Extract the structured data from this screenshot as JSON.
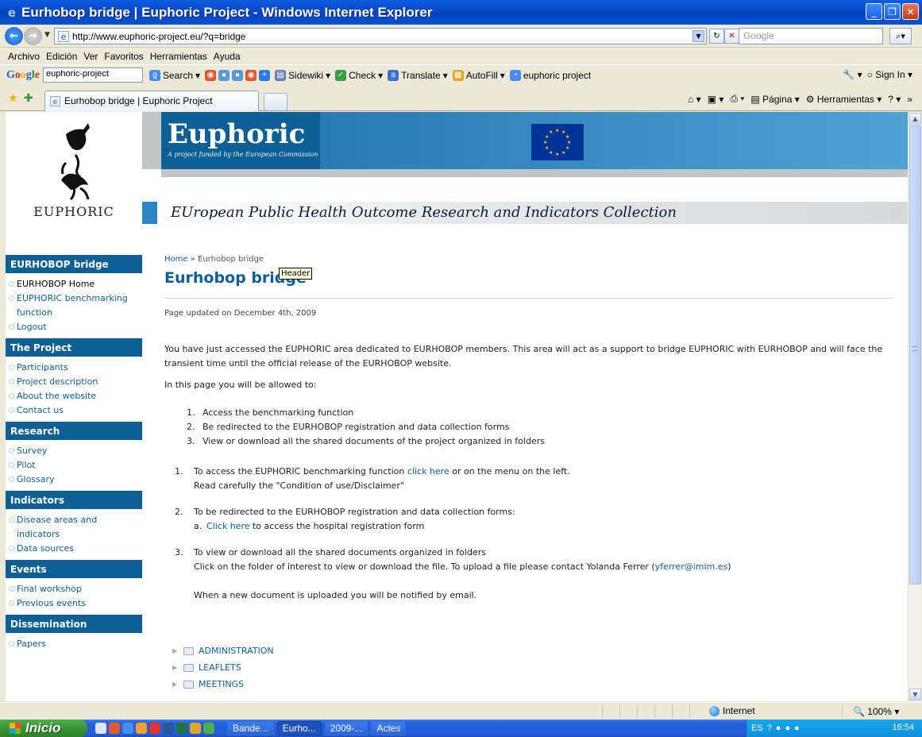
{
  "window": {
    "title": "Eurhobop bridge | Euphoric Project - Windows Internet Explorer"
  },
  "address": {
    "url": "http://www.euphoric-project.eu/?q=bridge",
    "search_placeholder": "Google"
  },
  "menu": [
    "Archivo",
    "Edición",
    "Ver",
    "Favoritos",
    "Herramientas",
    "Ayuda"
  ],
  "google_toolbar": {
    "search_value": "euphoric-project",
    "search_label": "Search",
    "sidewiki_label": "Sidewiki",
    "check_label": "Check",
    "translate_label": "Translate",
    "autofill_label": "AutoFill",
    "bookmark_label": "euphoric project",
    "signin_label": "Sign In"
  },
  "tab": {
    "title": "Eurhobop bridge | Euphoric Project"
  },
  "command_bar": {
    "page_label": "Página",
    "tools_label": "Herramientas"
  },
  "site": {
    "logo_wordmark": "EUPHORIC",
    "brand": "Euphoric",
    "brand_tagline": "A project funded by the European Commission",
    "subtitle": "EUropean Public Health Outcome Research and Indicators Collection"
  },
  "sidebar": {
    "sections": [
      {
        "title": "EURHOBOP bridge",
        "items": [
          "EURHOBOP Home",
          "EUPHORIC benchmarking function",
          "Logout"
        ]
      },
      {
        "title": "The Project",
        "items": [
          "Participants",
          "Project description",
          "About the website",
          "Contact us"
        ]
      },
      {
        "title": "Research",
        "items": [
          "Survey",
          "Pilot",
          "Glossary"
        ]
      },
      {
        "title": "Indicators",
        "items": [
          "Disease areas and indicators",
          "Data sources"
        ]
      },
      {
        "title": "Events",
        "items": [
          "Final workshop",
          "Previous events"
        ]
      },
      {
        "title": "Dissemination",
        "items": [
          "Papers"
        ]
      }
    ]
  },
  "main": {
    "breadcrumb_home": "Home",
    "breadcrumb_sep": " » ",
    "breadcrumb_current": "Eurhobop bridge",
    "title": "Eurhobop bridge",
    "tooltip": "Header",
    "updated": "Page updated on December 4th, 2009",
    "intro": "You have just accessed the EUPHORIC area dedicated to EURHOBOP members. This area will act as a support to bridge EUPHORIC with EURHOBOP and will face the transient time until the official release of the EURHOBOP website.",
    "allowed": "In this page you will be allowed to:",
    "allowed_list": [
      {
        "n": "1.",
        "text": "Access the benchmarking function"
      },
      {
        "n": "2.",
        "text": "Be redirected to the EURHOBOP registration and data collection forms"
      },
      {
        "n": "3.",
        "text": "View or download all the shared documents of the project organized in folders"
      }
    ],
    "item1": {
      "n": "1.",
      "pre": "To access the EUPHORIC benchmarking function ",
      "link": "click here",
      "post": " or on the menu on the left.",
      "line2": "Read carefully the \"Condition of use/Disclaimer\""
    },
    "item2": {
      "n": "2.",
      "text": "To be redirected to the EURHOBOP registration and data collection forms:",
      "sub_n": "a.",
      "sub_link": "Click here",
      "sub_post": " to access the hospital registration form"
    },
    "item3": {
      "n": "3.",
      "text": "To view or download all the shared documents organized in folders",
      "line2_pre": "Click on the folder of interest to view or download the file. To upload a file please contact Yolanda Ferrer (",
      "email": "yferrer@imim.es",
      "line2_post": ")",
      "line3": "When a new document is uploaded you will be notified by email."
    },
    "folders": [
      "ADMINISTRATION",
      "LEAFLETS",
      "MEETINGS"
    ]
  },
  "status": {
    "zone": "Internet",
    "zoom": "100%"
  },
  "taskbar": {
    "start": "Inicio",
    "tasks": [
      "Bande...",
      "Eurho...",
      "2009-...",
      "Actes"
    ],
    "lang": "ES",
    "clock": "16:54"
  }
}
